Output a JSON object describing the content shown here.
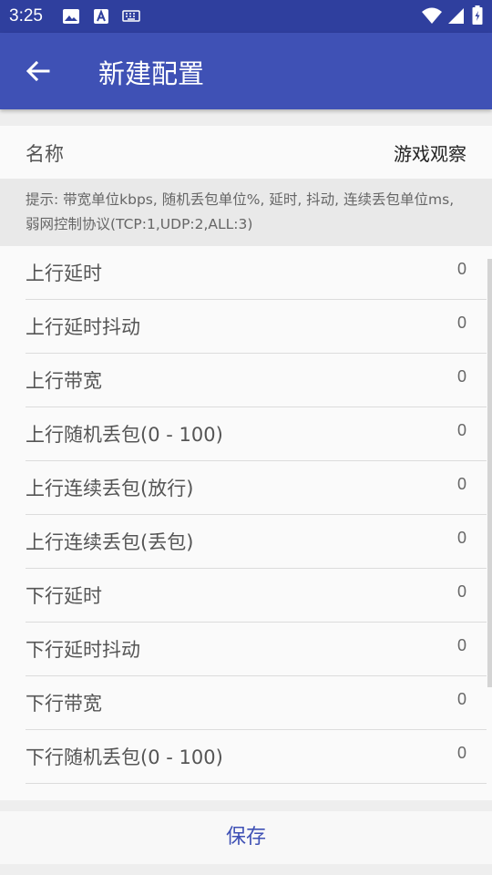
{
  "status_bar": {
    "time": "3:25",
    "icons_left": [
      "image-icon",
      "font-icon",
      "keyboard-icon"
    ],
    "icons_right": [
      "wifi-icon",
      "signal-icon",
      "battery-icon"
    ]
  },
  "app_bar": {
    "back_icon": "arrow-left-icon",
    "title": "新建配置",
    "color": "#3f51b5",
    "status_color": "#2f3f9e"
  },
  "name_field": {
    "label": "名称",
    "value": "游戏观察"
  },
  "hint": "提示: 带宽单位kbps, 随机丢包单位%, 延时, 抖动, 连续丢包单位ms, 弱网控制协议(TCP:1,UDP:2,ALL:3)",
  "settings": [
    {
      "label": "上行延时",
      "value": "0"
    },
    {
      "label": "上行延时抖动",
      "value": "0"
    },
    {
      "label": "上行带宽",
      "value": "0"
    },
    {
      "label": "上行随机丢包(0 - 100)",
      "value": "0"
    },
    {
      "label": "上行连续丢包(放行)",
      "value": "0"
    },
    {
      "label": "上行连续丢包(丢包)",
      "value": "0"
    },
    {
      "label": "下行延时",
      "value": "0"
    },
    {
      "label": "下行延时抖动",
      "value": "0"
    },
    {
      "label": "下行带宽",
      "value": "0"
    },
    {
      "label": "下行随机丢包(0 - 100)",
      "value": "0"
    }
  ],
  "save_label": "保存"
}
